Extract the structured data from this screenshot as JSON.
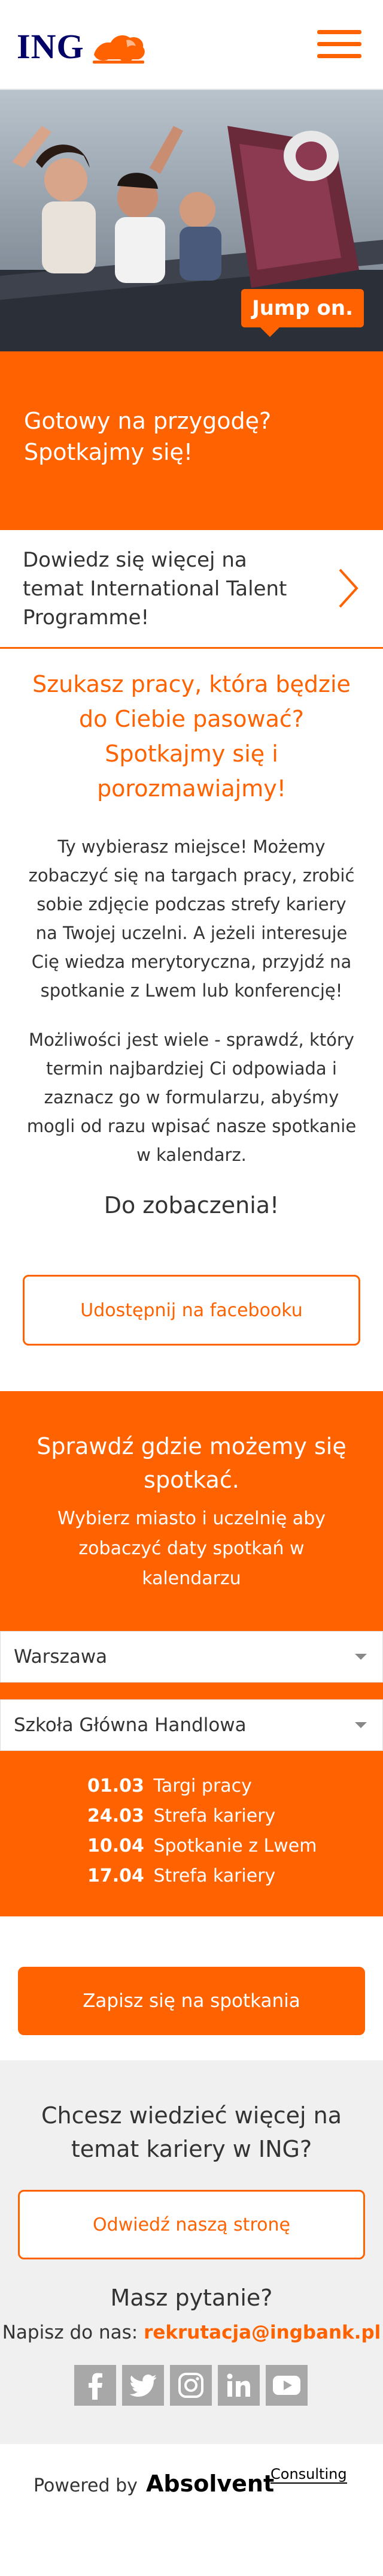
{
  "header": {
    "logo_text": "ING",
    "menu_icon": "hamburger-icon",
    "brand_color": "#ff6200"
  },
  "hero": {
    "badge": "Jump on."
  },
  "intro": {
    "line1": "Gotowy na przygodę?",
    "line2": "Spotkajmy się!"
  },
  "talent_link": {
    "text": "Dowiedz się więcej na temat International Talent Programme!",
    "icon": "chevron-right-icon"
  },
  "main": {
    "headline": "Szukasz pracy, która będzie do Ciebie pasować? Spotkajmy się i porozmawiajmy!",
    "paragraph1": "Ty wybierasz miejsce! Możemy zobaczyć się na targach pracy, zrobić sobie zdjęcie podczas strefy kariery na Twojej uczelni. A jeżeli interesuje Cię wiedza merytoryczna, przyjdź na spotkanie z Lwem lub konferencję!",
    "paragraph2": "Możliwości jest wiele - sprawdź, który termin najbardziej Ci odpowiada i zaznacz go w formularzu, abyśmy mogli od razu wpisać nasze spotkanie w kalendarz.",
    "see_you": "Do zobaczenia!",
    "facebook_button": "Udostępnij na facebooku"
  },
  "events": {
    "title": "Sprawdź gdzie możemy się spotkać.",
    "subtitle": "Wybierz miasto i uczelnię aby zobaczyć daty spotkań w kalendarzu",
    "city_select": "Warszawa",
    "university_select": "Szkoła Główna Handlowa",
    "dates": [
      {
        "date": "01.03",
        "label": "Targi pracy"
      },
      {
        "date": "24.03",
        "label": "Strefa kariery"
      },
      {
        "date": "10.04",
        "label": "Spotkanie z Lwem"
      },
      {
        "date": "17.04",
        "label": "Strefa kariery"
      }
    ],
    "signup_button": "Zapisz się na spotkania"
  },
  "career": {
    "title": "Chcesz wiedzieć więcej na temat kariery w ING?",
    "visit_button": "Odwiedź naszą stronę",
    "question": "Masz pytanie?",
    "write_prefix": "Napisz do nas:",
    "email": "rekrutacja@ingbank.pl",
    "socials": [
      "facebook-icon",
      "twitter-icon",
      "instagram-icon",
      "linkedin-icon",
      "youtube-icon"
    ]
  },
  "footer": {
    "powered_label": "Powered by",
    "brand": "Absolvent",
    "brand_sub": "Consulting"
  }
}
